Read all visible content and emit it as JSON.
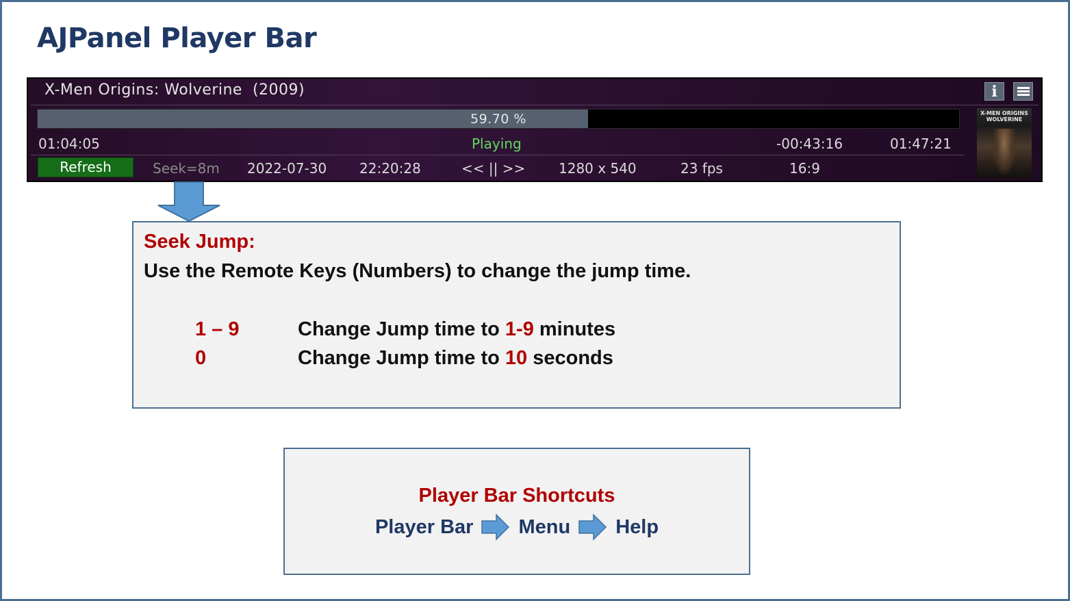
{
  "slide": {
    "title": "AJPanel Player Bar"
  },
  "player": {
    "title": "X-Men Origins: Wolverine  (2009)",
    "progress_percent": 59.7,
    "progress_label": "59.70 %",
    "elapsed": "01:04:05",
    "status": "Playing",
    "remaining": "-00:43:16",
    "total": "01:47:21",
    "refresh_label": "Refresh",
    "seek": "Seek=8m",
    "date": "2022-07-30",
    "time": "22:20:28",
    "controls": "<< || >>",
    "resolution": "1280 x 540",
    "fps": "23 fps",
    "aspect": "16:9",
    "info_icon_glyph": "i",
    "poster_title": "X-MEN ORIGINS WOLVERINE",
    "icons": [
      "info-icon",
      "menu-icon"
    ],
    "colors": {
      "status": "#5fdc5f",
      "refresh_bg": "#156d17",
      "progress_fill": "#56606f"
    }
  },
  "callout": {
    "heading": "Seek Jump:",
    "description": "Use the Remote Keys (Numbers) to change the jump time.",
    "rows": [
      {
        "key": "1 – 9",
        "prefix": "Change Jump time to ",
        "value": "1-9",
        "suffix": " minutes"
      },
      {
        "key": "0",
        "prefix": "Change Jump time to ",
        "value": "10",
        "suffix": " seconds"
      }
    ]
  },
  "shortcuts": {
    "heading": "Player Bar Shortcuts",
    "path": [
      "Player Bar",
      "Menu",
      "Help"
    ]
  },
  "colors": {
    "title": "#1f3864",
    "accent_red": "#b00000",
    "box_border": "#4a6f92",
    "arrow": "#5b9bd5"
  }
}
